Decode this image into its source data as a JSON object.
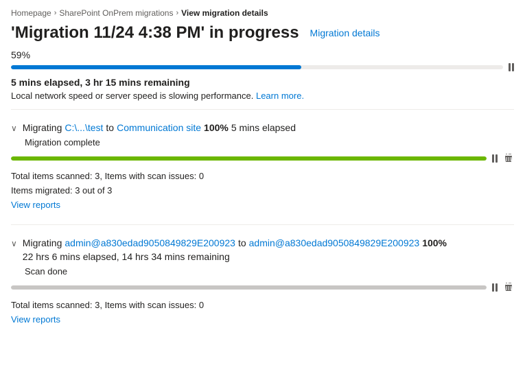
{
  "breadcrumb": {
    "items": [
      {
        "label": "Homepage",
        "link": true
      },
      {
        "label": "SharePoint OnPrem migrations",
        "link": true
      },
      {
        "label": "View migration details",
        "link": false
      }
    ]
  },
  "page": {
    "title": "'Migration 11/24 4:38 PM' in progress",
    "migration_details_link": "Migration details"
  },
  "overall_progress": {
    "percent": "59%",
    "time_elapsed": "5 mins elapsed, 3 hr 15 mins remaining",
    "warning": "Local network speed or server speed is slowing performance.",
    "learn_more": "Learn more.",
    "bar_color": "#0078d4",
    "bar_width": "59"
  },
  "migrations": [
    {
      "id": "migration-1",
      "chevron": "∨",
      "migrating_label": "Migrating",
      "source_path": "C:\\...\\test",
      "to_label": "to",
      "dest": "Communication site",
      "percent": "100%",
      "elapsed": "5 mins elapsed",
      "status": "Migration complete",
      "bar_color": "#6bb700",
      "bar_width": "100",
      "stats": [
        "Total items scanned: 3, Items with scan issues: 0",
        "Items migrated: 3 out of 3"
      ],
      "view_reports": "View reports"
    },
    {
      "id": "migration-2",
      "chevron": "∨",
      "migrating_label": "Migrating",
      "source_path": "admin@a830edad9050849829E200923",
      "to_label": "to",
      "dest": "admin@a830edad9050849829E200923",
      "percent": "100%",
      "elapsed": "22 hrs 6 mins elapsed, 14 hrs 34 mins remaining",
      "status": "Scan done",
      "bar_color": "#edebe9",
      "bar_width": "100",
      "stats": [
        "Total items scanned: 3, Items with scan issues: 0"
      ],
      "view_reports": "View reports"
    }
  ]
}
